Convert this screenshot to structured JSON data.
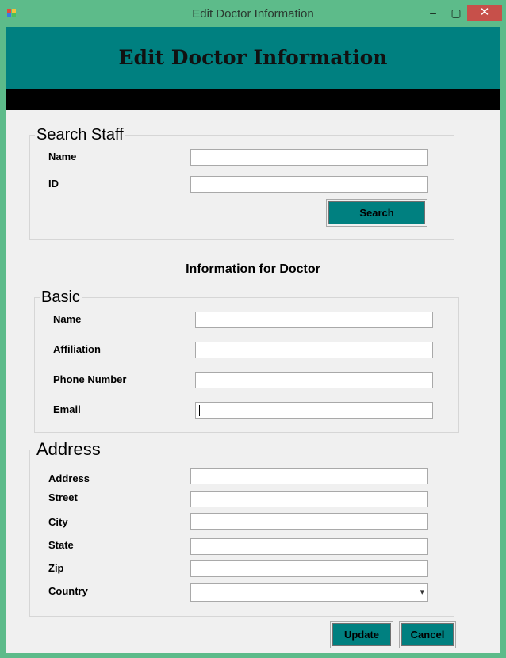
{
  "window": {
    "title": "Edit Doctor Information",
    "min_label": "‒",
    "max_label": "▢",
    "close_label": "✕"
  },
  "banner": {
    "title": "Edit Doctor Information"
  },
  "search_staff": {
    "legend": "Search Staff",
    "name_label": "Name",
    "name_value": "",
    "id_label": "ID",
    "id_value": "",
    "search_button": "Search"
  },
  "info_heading": "Information for Doctor",
  "basic": {
    "legend": "Basic",
    "name_label": "Name",
    "name_value": "",
    "affiliation_label": "Affiliation",
    "affiliation_value": "",
    "phone_label": "Phone Number",
    "phone_value": "",
    "email_label": "Email",
    "email_value": ""
  },
  "address": {
    "legend": "Address",
    "address_label": "Address",
    "address_value": "",
    "street_label": "Street",
    "street_value": "",
    "city_label": "City",
    "city_value": "",
    "state_label": "State",
    "state_value": "",
    "zip_label": "Zip",
    "zip_value": "",
    "country_label": "Country",
    "country_value": ""
  },
  "actions": {
    "update_label": "Update",
    "cancel_label": "Cancel"
  },
  "colors": {
    "banner": "#008080",
    "frame": "#5dbb8a",
    "close": "#c7504a"
  }
}
